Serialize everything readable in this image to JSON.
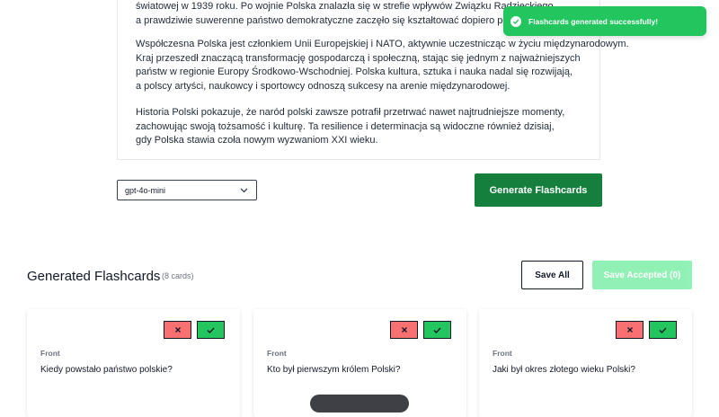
{
  "text_panel": {
    "paragraphs": [
      [
        "światowej w 1939 roku. Po wojnie Polska znalazła się w strefie wpływów Związku Radzieckiego,",
        "a prawdziwie suwerenne państwo demokratyczne zaczęło się kształtować dopiero po 1989 roku."
      ],
      [
        "Współczesna Polska jest członkiem Unii Europejskiej i NATO, aktywnie uczestnicząc w życiu międzynarodowym.",
        "Kraj przeszedł znaczącą transformację gospodarczą i społeczną, stając się jednym z najważniejszych",
        "państw w regionie Europy Środkowo-Wschodniej. Polska kultura, sztuka i nauka nadal się rozwijają,",
        "a polscy artyści, naukowcy i sportowcy odnoszą sukcesy na arenie międzynarodowej."
      ],
      [
        "Historia Polski pokazuje, że naród polski zawsze potrafił przetrwać nawet najtrudniejsze momenty,",
        "zachowując swoją tożsamość i kulturę. Ta resilience i determinacja są widoczne również dzisiaj,",
        "gdy Polska stawia czoła nowym wyzwaniom XXI wieku."
      ]
    ]
  },
  "toast": {
    "message": "Flashcards generated successfully!",
    "icon": "check-circle-icon"
  },
  "controls": {
    "model_value": "gpt-4o-mini",
    "generate_label": "Generate Flashcards"
  },
  "section": {
    "title": "Generated Flashcards",
    "count": "(8 cards)",
    "save_all_label": "Save All",
    "save_accepted_label": "Save Accepted (0)"
  },
  "cards": [
    {
      "front_label": "Front",
      "question": "Kiedy powstało państwo polskie?"
    },
    {
      "front_label": "Front",
      "question": "Kto był pierwszym królem Polski?"
    },
    {
      "front_label": "Front",
      "question": "Jaki był okres złotego wieku Polski?"
    }
  ],
  "colors": {
    "accent": "#15803d",
    "toast": "#22c55e",
    "reject": "#f87171",
    "accept": "#22c55e"
  }
}
